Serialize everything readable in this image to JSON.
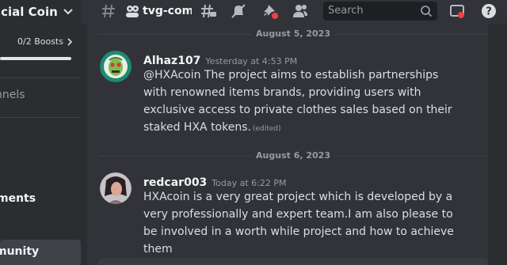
{
  "server": {
    "name": "icial Coin",
    "boosts": "0/2 Boosts",
    "boost_progress": 0
  },
  "sidebar": {
    "channels_partial": "nnels",
    "items": [
      {
        "label": "ments"
      },
      {
        "label": "munity"
      }
    ]
  },
  "topbar": {
    "channel_name": "tvg-comm",
    "search_placeholder": "Search",
    "icons": [
      "hashtag-icon",
      "community-icon",
      "threads-icon",
      "mute-bell-icon",
      "pin-icon",
      "members-icon",
      "search-icon",
      "inbox-icon",
      "help-icon"
    ]
  },
  "messages": [
    {
      "date": "August 5, 2023",
      "author": "Alhaz107",
      "timestamp": "Yesterday at 4:53 PM",
      "text": "@HXAcoin The project aims to establish partnerships with renowned items brands, providing users with exclusive access to private clothes sales based on their staked HXA tokens.",
      "edited": "(edited)",
      "avatar_color": "#1e8a73"
    },
    {
      "date": "August 6, 2023",
      "author": "redcar003",
      "timestamp": "Today at 6:22 PM",
      "text": "HXAcoin is a very great project which is developed by a very professionally and expert team.I am also please to be involved in a worth while project and how to achieve them",
      "avatar_color": "#c7c2c6"
    }
  ]
}
